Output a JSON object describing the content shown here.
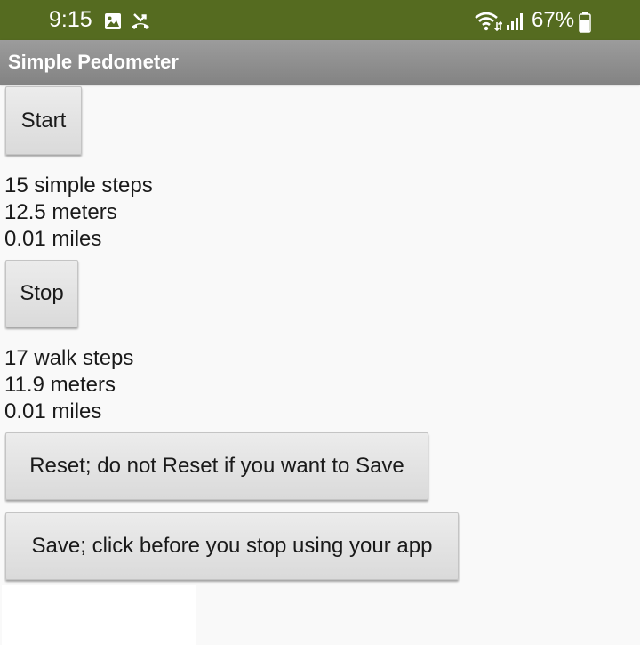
{
  "status_bar": {
    "time": "9:15",
    "battery_percent": "67%",
    "battery_level": 0.67,
    "icons": [
      "image-icon",
      "missed-call-icon",
      "wifi-icon",
      "signal-icon",
      "battery-icon"
    ],
    "background_color": "#556b20"
  },
  "app": {
    "title": "Simple Pedometer"
  },
  "simple_section": {
    "start_label": "Start",
    "steps": "15 simple steps",
    "meters": "12.5 meters",
    "miles": "0.01 miles"
  },
  "walk_section": {
    "stop_label": "Stop",
    "steps": "17 walk steps",
    "meters": "11.9 meters",
    "miles": "0.01 miles"
  },
  "actions": {
    "reset_label": "Reset; do not Reset if you want to Save",
    "save_label": "Save; click before you stop using your app"
  }
}
